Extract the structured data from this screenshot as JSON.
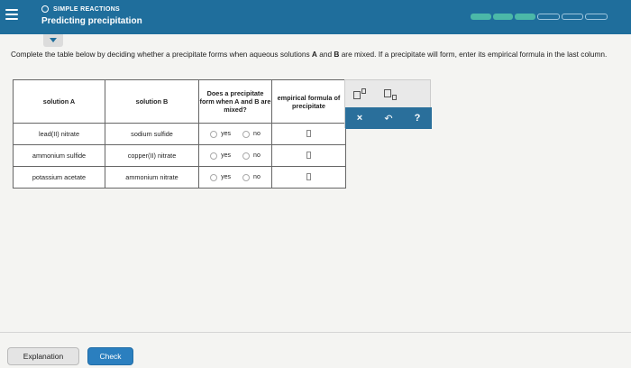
{
  "header": {
    "section_label": "SIMPLE REACTIONS",
    "topic_title": "Predicting precipitation",
    "progress": {
      "total_segments": 6,
      "completed_segments": 3
    }
  },
  "instructions": {
    "part1": "Complete the table below by deciding whether a precipitate forms when aqueous solutions ",
    "a": "A",
    "part2": " and ",
    "b": "B",
    "part3": " are mixed. If a precipitate will form, enter its empirical formula in the last column."
  },
  "table": {
    "headers": [
      "solution A",
      "solution B",
      "Does a precipitate form when A and B are mixed?",
      "empirical formula of precipitate"
    ],
    "rows": [
      {
        "solution_a": "lead(II) nitrate",
        "solution_b": "sodium sulfide"
      },
      {
        "solution_a": "ammonium sulfide",
        "solution_b": "copper(II) nitrate"
      },
      {
        "solution_a": "potassium acetate",
        "solution_b": "ammonium nitrate"
      }
    ],
    "yes_label": "yes",
    "no_label": "no"
  },
  "palette": {
    "clear_symbol": "×",
    "undo_symbol": "↶",
    "help_symbol": "?"
  },
  "footer": {
    "explanation_label": "Explanation",
    "check_label": "Check"
  },
  "colors": {
    "header": "#1f6e9c",
    "progress_filled": "#4bb8a8",
    "check_button": "#2b7fbf"
  }
}
